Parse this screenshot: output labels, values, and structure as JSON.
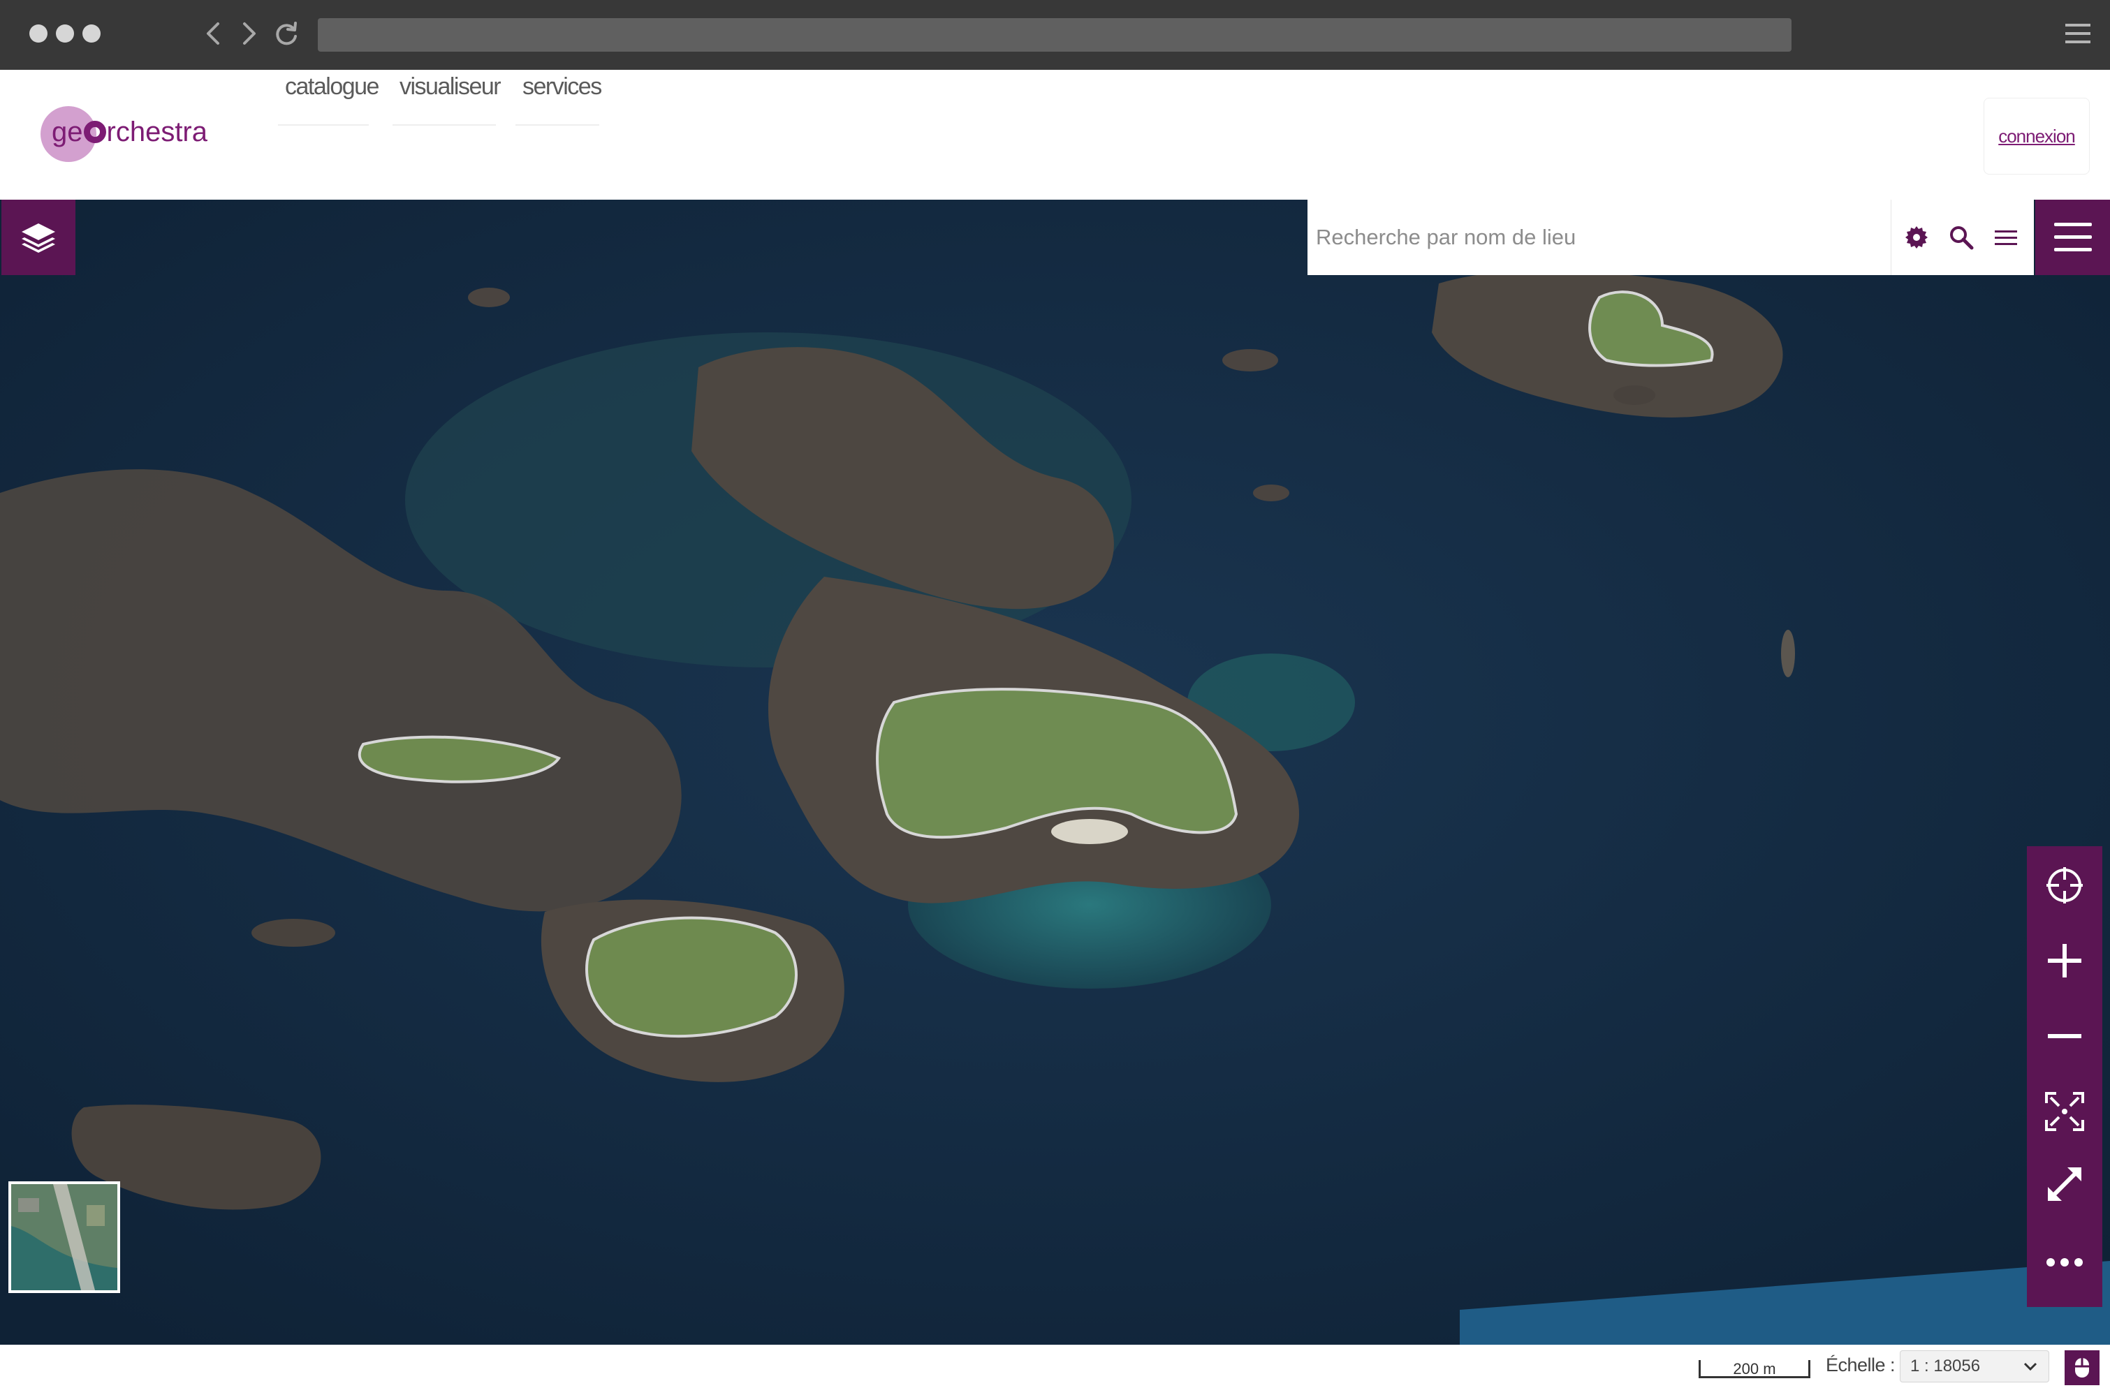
{
  "header": {
    "logo_text": "georchestra",
    "nav": [
      {
        "label": "catalogue"
      },
      {
        "label": "visualiseur"
      },
      {
        "label": "services"
      }
    ],
    "login_label": "connexion"
  },
  "search": {
    "placeholder": "Recherche par nom de lieu"
  },
  "footer": {
    "scalebar_label": "200 m",
    "scale_label": "Échelle :",
    "scale_value": "1 : 18056"
  },
  "icons": {
    "layers": "layers-icon",
    "settings": "gear-icon",
    "search": "search-icon",
    "menu": "menu-icon",
    "locate": "crosshair-icon",
    "zoom_in": "plus-icon",
    "zoom_out": "minus-icon",
    "zoom_extent": "zoom-extent-icon",
    "fullscreen": "expand-icon",
    "more": "more-icon",
    "mouse": "mouse-icon"
  },
  "colors": {
    "brand": "#5b1553",
    "logo_purple": "#7d1c74",
    "logo_circle": "#d3a0cf",
    "chrome": "#383838",
    "sea": "#142a3e"
  }
}
